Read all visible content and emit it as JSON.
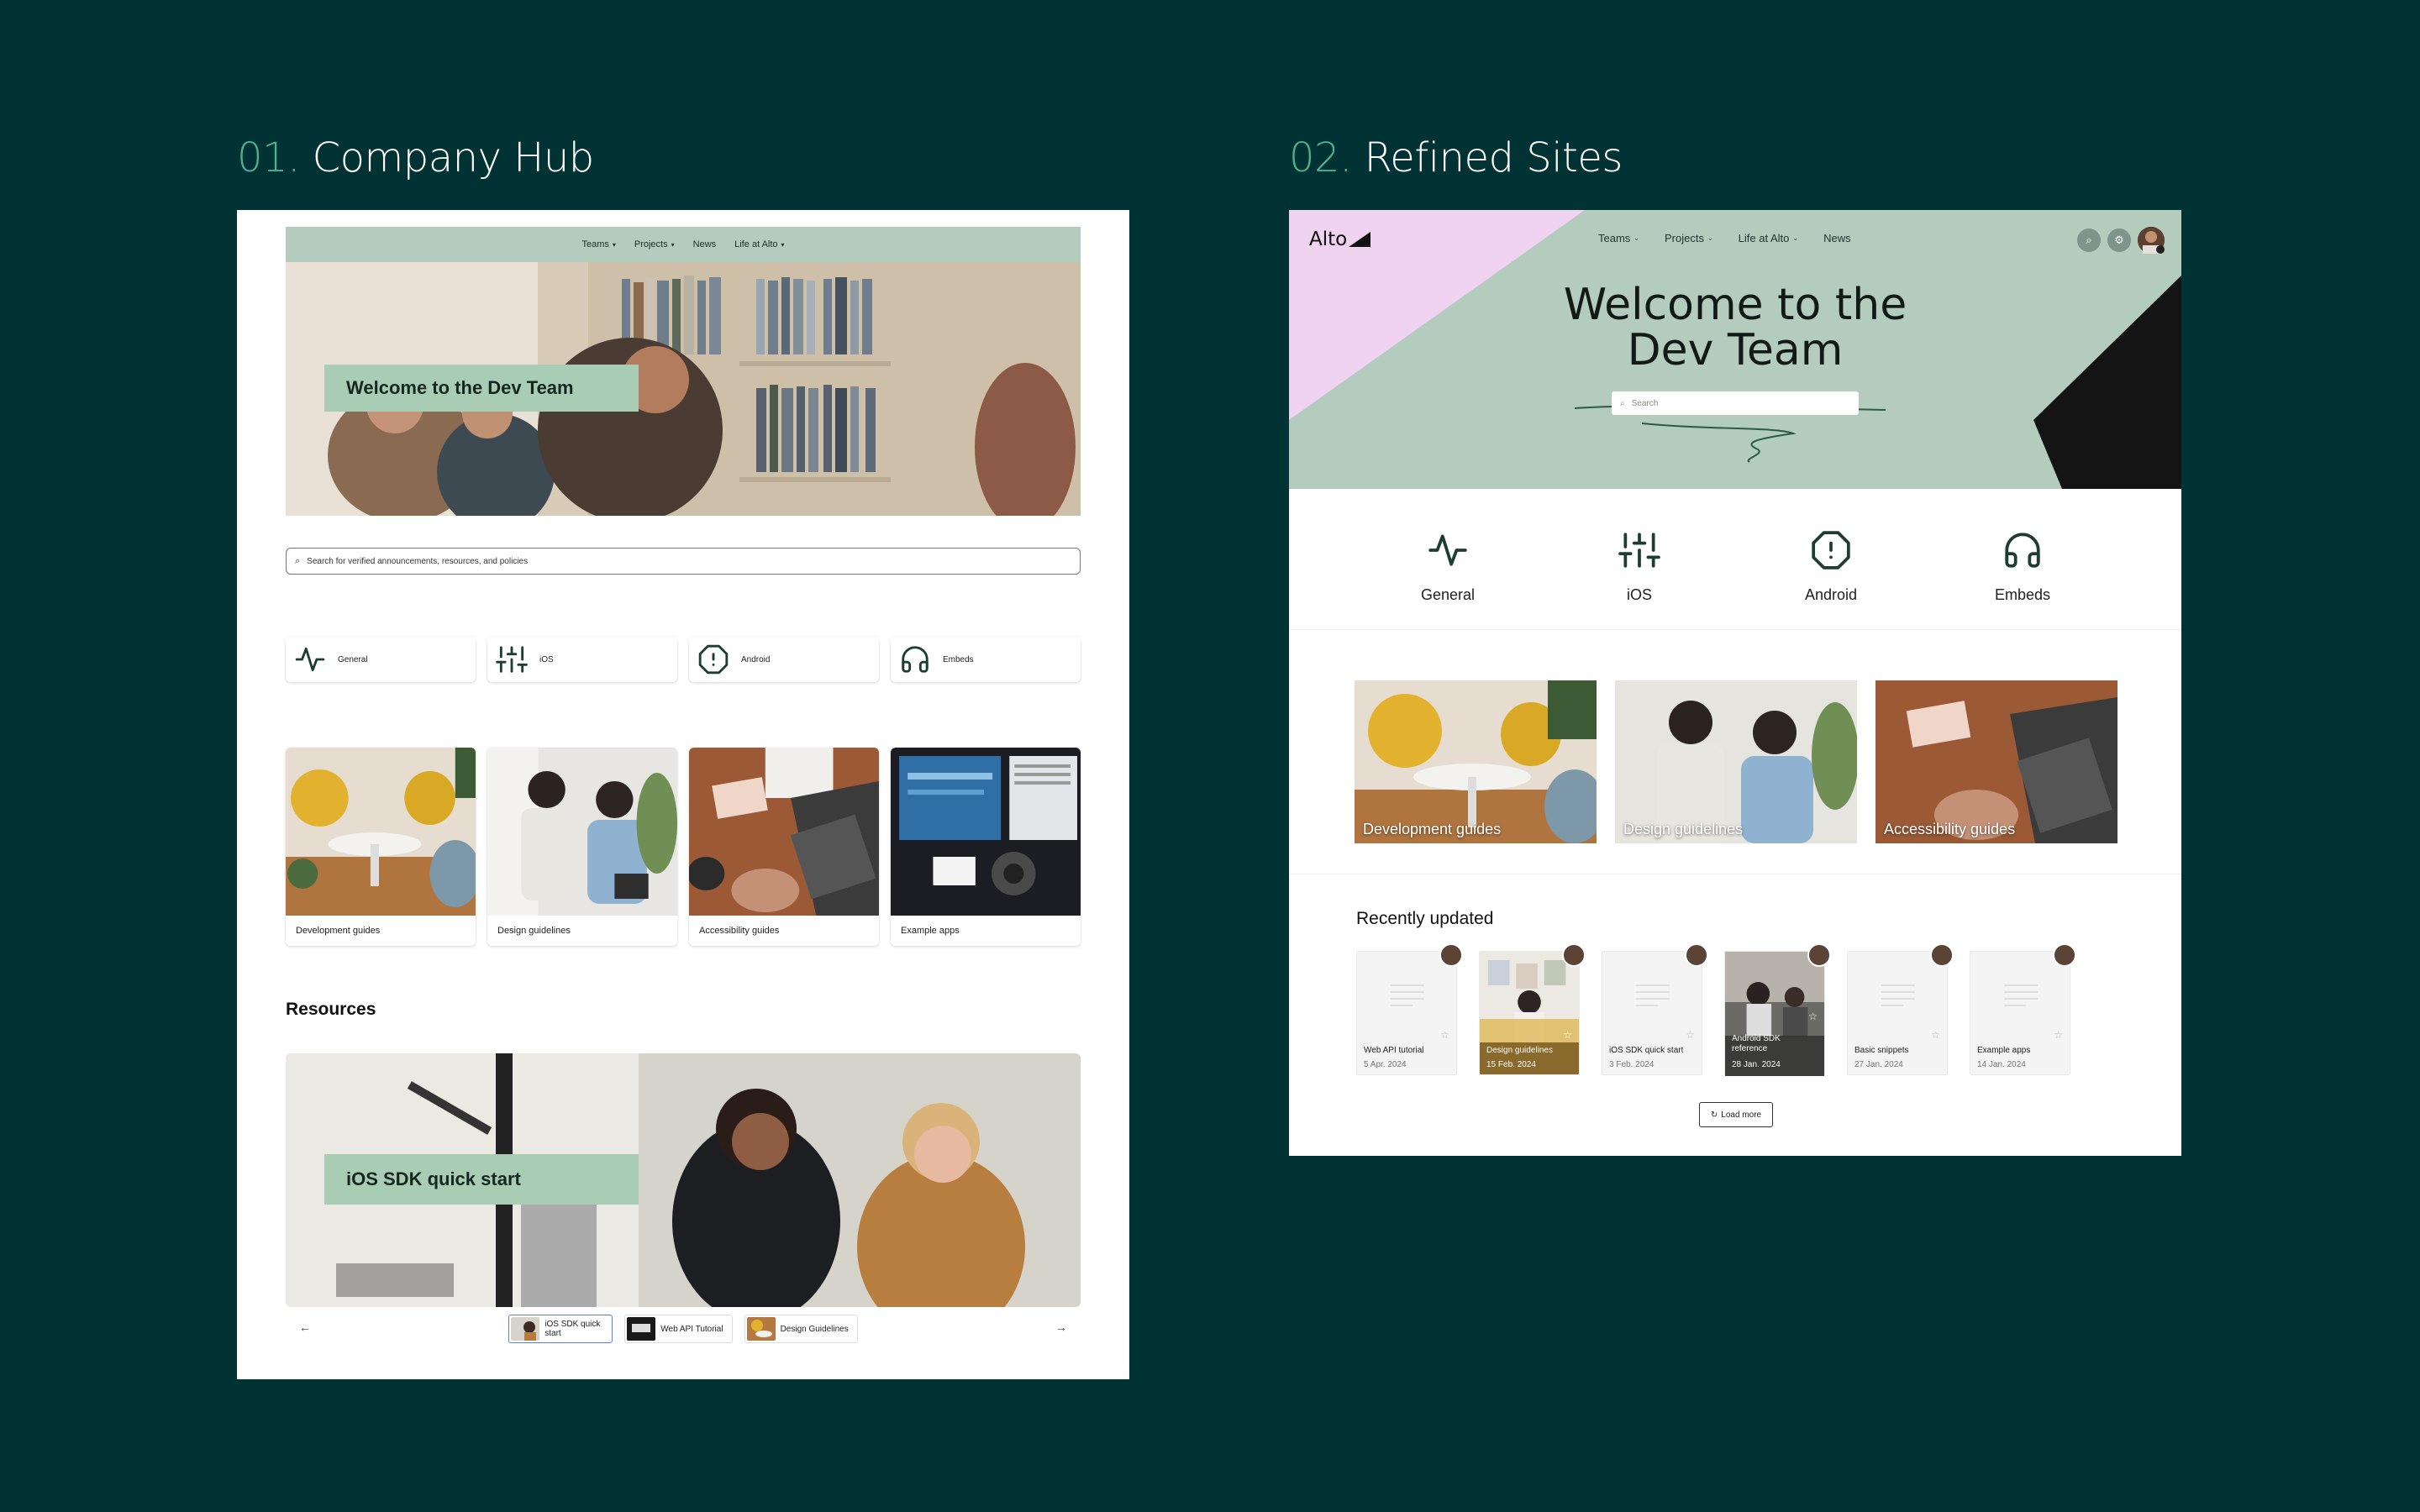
{
  "sections": [
    {
      "num": "01.",
      "title": "Company Hub"
    },
    {
      "num": "02.",
      "title": "Refined Sites"
    }
  ],
  "hub": {
    "nav": [
      "Teams",
      "Projects",
      "News",
      "Life at Alto"
    ],
    "hero_title": "Welcome to the Dev Team",
    "search_placeholder": "Search for verified announcements, resources, and policies",
    "categories": [
      {
        "label": "General",
        "icon": "pulse-icon"
      },
      {
        "label": "iOS",
        "icon": "sliders-icon"
      },
      {
        "label": "Android",
        "icon": "alert-octagon-icon"
      },
      {
        "label": "Embeds",
        "icon": "headphones-icon"
      }
    ],
    "guides": [
      "Development guides",
      "Design guidelines",
      "Accessibility guides",
      "Example apps"
    ],
    "resources_title": "Resources",
    "resource_hero_title": "iOS SDK quick start",
    "carousel": [
      "iOS SDK quick start",
      "Web API Tutorial",
      "Design Guidelines"
    ]
  },
  "refined": {
    "logo": "Alto",
    "nav": [
      "Teams",
      "Projects",
      "Life at Alto",
      "News"
    ],
    "hero_title_line1": "Welcome to the",
    "hero_title_line2": "Dev Team",
    "search_placeholder": "Search",
    "categories": [
      {
        "label": "General",
        "icon": "pulse-icon"
      },
      {
        "label": "iOS",
        "icon": "sliders-icon"
      },
      {
        "label": "Android",
        "icon": "alert-octagon-icon"
      },
      {
        "label": "Embeds",
        "icon": "headphones-icon"
      }
    ],
    "guides": [
      "Development guides",
      "Design guidelines",
      "Accessibility guides"
    ],
    "recent_title": "Recently updated",
    "recent": [
      {
        "title": "Web API tutorial",
        "date": "5 Apr. 2024"
      },
      {
        "title": "Design guidelines",
        "date": "15 Feb. 2024"
      },
      {
        "title": "iOS SDK quick start",
        "date": "3 Feb. 2024"
      },
      {
        "title": "Android SDK reference",
        "date": "28 Jan. 2024"
      },
      {
        "title": "Basic snippets",
        "date": "27 Jan. 2024"
      },
      {
        "title": "Example apps",
        "date": "14 Jan. 2024"
      }
    ],
    "load_more": "Load more"
  },
  "colors": {
    "background": "#013334",
    "accent": "#4fb08f",
    "sage": "#b3ccbd",
    "pink": "#efd3f1"
  }
}
